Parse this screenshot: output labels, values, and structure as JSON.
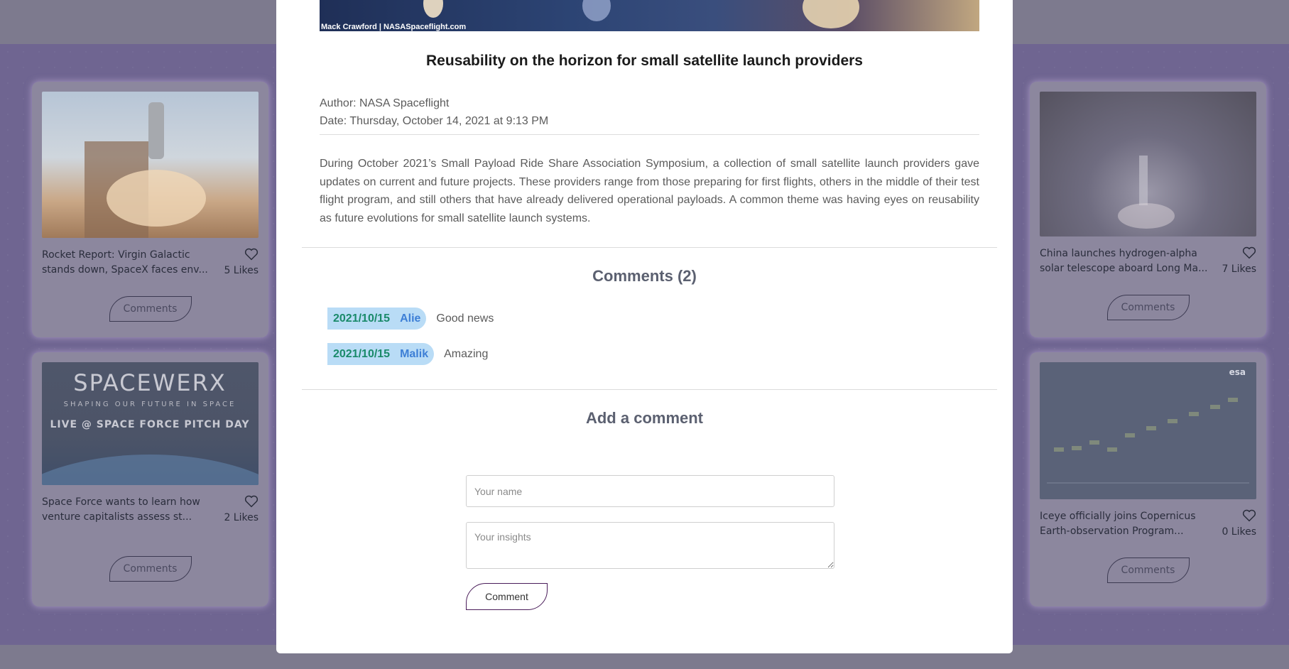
{
  "modal": {
    "hero_credit": "Mack Crawford | NASASpaceflight.com",
    "title": "Reusability on the horizon for small satellite launch providers",
    "author": "Author: NASA Spaceflight",
    "date": "Date: Thursday, October 14, 2021 at 9:13 PM",
    "description": "During October 2021’s Small Payload Ride Share Association Symposium, a collection of small satellite launch providers gave updates on current and future projects. These providers range from those preparing for first flights, others in the middle of their test flight program, and still others that have already delivered operational payloads. A common theme was having eyes on reusability as future evolutions for small satellite launch systems.",
    "comments_title": "Comments (2)",
    "comments": [
      {
        "date": "2021/10/15",
        "name": "Alie",
        "text": "Good news"
      },
      {
        "date": "2021/10/15",
        "name": "Malik",
        "text": "Amazing"
      }
    ],
    "add_comment_title": "Add a comment",
    "name_placeholder": "Your name",
    "insights_placeholder": "Your insights",
    "comment_button": "Comment"
  },
  "cards": [
    {
      "title": "Rocket Report: Virgin Galactic stands down, SpaceX faces env...",
      "likes": "5 Likes",
      "button": "Comments"
    },
    {
      "title": "China launches hydrogen-alpha solar telescope aboard Long Ma...",
      "likes": "7 Likes",
      "button": "Comments"
    },
    {
      "title": "Space Force wants to learn how venture capitalists assess st...",
      "likes": "2 Likes",
      "button": "Comments",
      "img_text_1": "SPACEWERX",
      "img_text_2": "SHAPING OUR FUTURE IN SPACE",
      "img_text_3": "LIVE @ SPACE FORCE PITCH DAY"
    },
    {
      "title": "Iceye officially joins Copernicus Earth-observation Program...",
      "likes": "0 Likes",
      "button": "Comments",
      "img_text_1": "esa"
    }
  ],
  "colors": {
    "accent_green": "#1a8a6a",
    "accent_blue": "#3d7fd6",
    "badge_bg": "#b9dcf6",
    "page_bg": "#6f6591"
  }
}
